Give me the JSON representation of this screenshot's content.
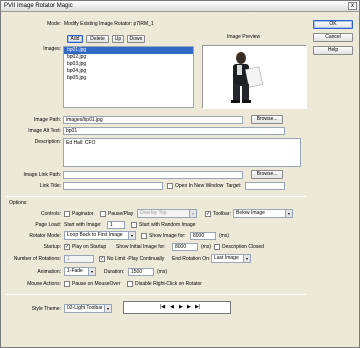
{
  "window": {
    "title": "PVII Image Rotator Magic",
    "close_glyph": "x"
  },
  "dialog_buttons": {
    "ok": "OK",
    "cancel": "Cancel",
    "help": "Help"
  },
  "mode": {
    "label": "Mode:",
    "value": "Modify Existing Image Rotator: p7IRM_1"
  },
  "images": {
    "label": "Images:",
    "buttons": {
      "add": "Add",
      "delete": "Delete",
      "up": "Up",
      "down": "Down"
    },
    "list": [
      "bp01.jpg",
      "bp02.jpg",
      "bp03.jpg",
      "bp04.jpg",
      "bp05.jpg"
    ],
    "selected_index": 0,
    "preview_label": "Image Preview"
  },
  "image_path": {
    "label": "Image Path:",
    "value": "images/bp01.jpg",
    "browse": "Browse..."
  },
  "image_alt": {
    "label": "Image Alt Text:",
    "value": "bp01"
  },
  "description": {
    "label": "Description:",
    "value": "Ed Hall: CFO"
  },
  "image_link_path": {
    "label": "Image Link Path:",
    "value": "",
    "browse": "Browse..."
  },
  "link_title": {
    "label": "Link Title:",
    "value": "",
    "new_window_label": "Open In New Window",
    "new_window_checked": false,
    "target_label": "Target:",
    "target_value": ""
  },
  "options_label": "Options:",
  "controls": {
    "label": "Controls:",
    "paginator_label": "Paginator",
    "paginator_checked": false,
    "pause_play_label": "Pause/Play",
    "pause_play_checked": false,
    "overlay_value": "Overlay Top",
    "toolbar_label": "Toolbar:",
    "toolbar_checked": true,
    "toolbar_value": "Below Image"
  },
  "page_load": {
    "label": "Page Load:",
    "start_with_label": "Start with Image:",
    "start_with_value": "1",
    "random_label": "Start with Random Image",
    "random_checked": false
  },
  "rotator_mode": {
    "label": "Rotator Mode:",
    "value": "Loop Back to First Image",
    "show_image_for_label": "Show Image for:",
    "show_image_for_value": "8000",
    "unit": "(ms)"
  },
  "startup": {
    "label": "Startup:",
    "play_label": "Play on Startup",
    "play_checked": true,
    "initial_label": "Show Initial Image for:",
    "initial_value": "8000",
    "unit": "(ms)",
    "desc_closed_label": "Description Closed",
    "desc_closed_checked": false
  },
  "rotations": {
    "label": "Number of Rotations:",
    "value": "1",
    "no_limit_label": "No Limit -Play Continually",
    "no_limit_checked": true,
    "end_label": "End Rotation On:",
    "end_value": "Last Image"
  },
  "animation": {
    "label": "Animation:",
    "value": "1-Fade",
    "duration_label": "Duration:",
    "duration_value": "1500",
    "unit": "(ms)"
  },
  "mouse_actions": {
    "label": "Mouse Actions:",
    "pause_label": "Pause on MouseOver",
    "pause_checked": false,
    "disable_label": "Disable Right-Click on Rotator",
    "disable_checked": false
  },
  "style_theme": {
    "label": "Style Theme:",
    "value": "02-Light Toolbar"
  },
  "colors": {
    "dialog_bg": "#ece9d8",
    "accent": "#2f62c8",
    "select_bg": "#3169c6"
  },
  "icons": [
    "close-icon",
    "dropdown-arrow-icon",
    "first-icon",
    "previous-icon",
    "play-icon",
    "next-icon",
    "last-icon"
  ]
}
